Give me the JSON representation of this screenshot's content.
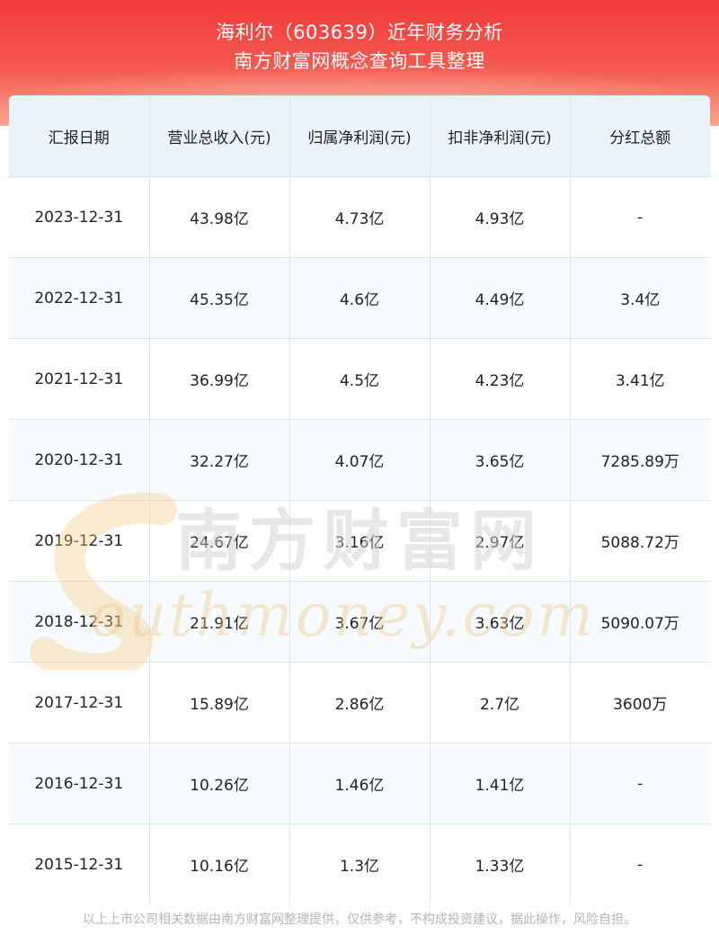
{
  "header": {
    "title_line1": "海利尔（603639）近年财务分析",
    "title_line2": "南方财富网概念查询工具整理"
  },
  "table": {
    "columns": [
      "汇报日期",
      "营业总收入(元)",
      "归属净利润(元)",
      "扣非净利润(元)",
      "分红总额"
    ],
    "rows": [
      [
        "2023-12-31",
        "43.98亿",
        "4.73亿",
        "4.93亿",
        "-"
      ],
      [
        "2022-12-31",
        "45.35亿",
        "4.6亿",
        "4.49亿",
        "3.4亿"
      ],
      [
        "2021-12-31",
        "36.99亿",
        "4.5亿",
        "4.23亿",
        "3.41亿"
      ],
      [
        "2020-12-31",
        "32.27亿",
        "4.07亿",
        "3.65亿",
        "7285.89万"
      ],
      [
        "2019-12-31",
        "24.67亿",
        "3.16亿",
        "2.97亿",
        "5088.72万"
      ],
      [
        "2018-12-31",
        "21.91亿",
        "3.67亿",
        "3.63亿",
        "5090.07万"
      ],
      [
        "2017-12-31",
        "15.89亿",
        "2.86亿",
        "2.7亿",
        "3600万"
      ],
      [
        "2016-12-31",
        "10.26亿",
        "1.46亿",
        "1.41亿",
        "-"
      ],
      [
        "2015-12-31",
        "10.16亿",
        "1.3亿",
        "1.33亿",
        "-"
      ]
    ]
  },
  "watermark": {
    "cn": "南方财富网",
    "en": "outhmoney.com"
  },
  "footer": {
    "disclaimer": "以上上市公司相关数据由南方财富网整理提供，仅供参考，不构成投资建议，据此操作，风险自担。"
  },
  "colors": {
    "header_red": "#f23a3a",
    "header_bg_accent": "#f7a28e",
    "table_header_bg": "#e9f3fc",
    "border": "#dde6ee",
    "footer_text": "#b5b5b5"
  }
}
